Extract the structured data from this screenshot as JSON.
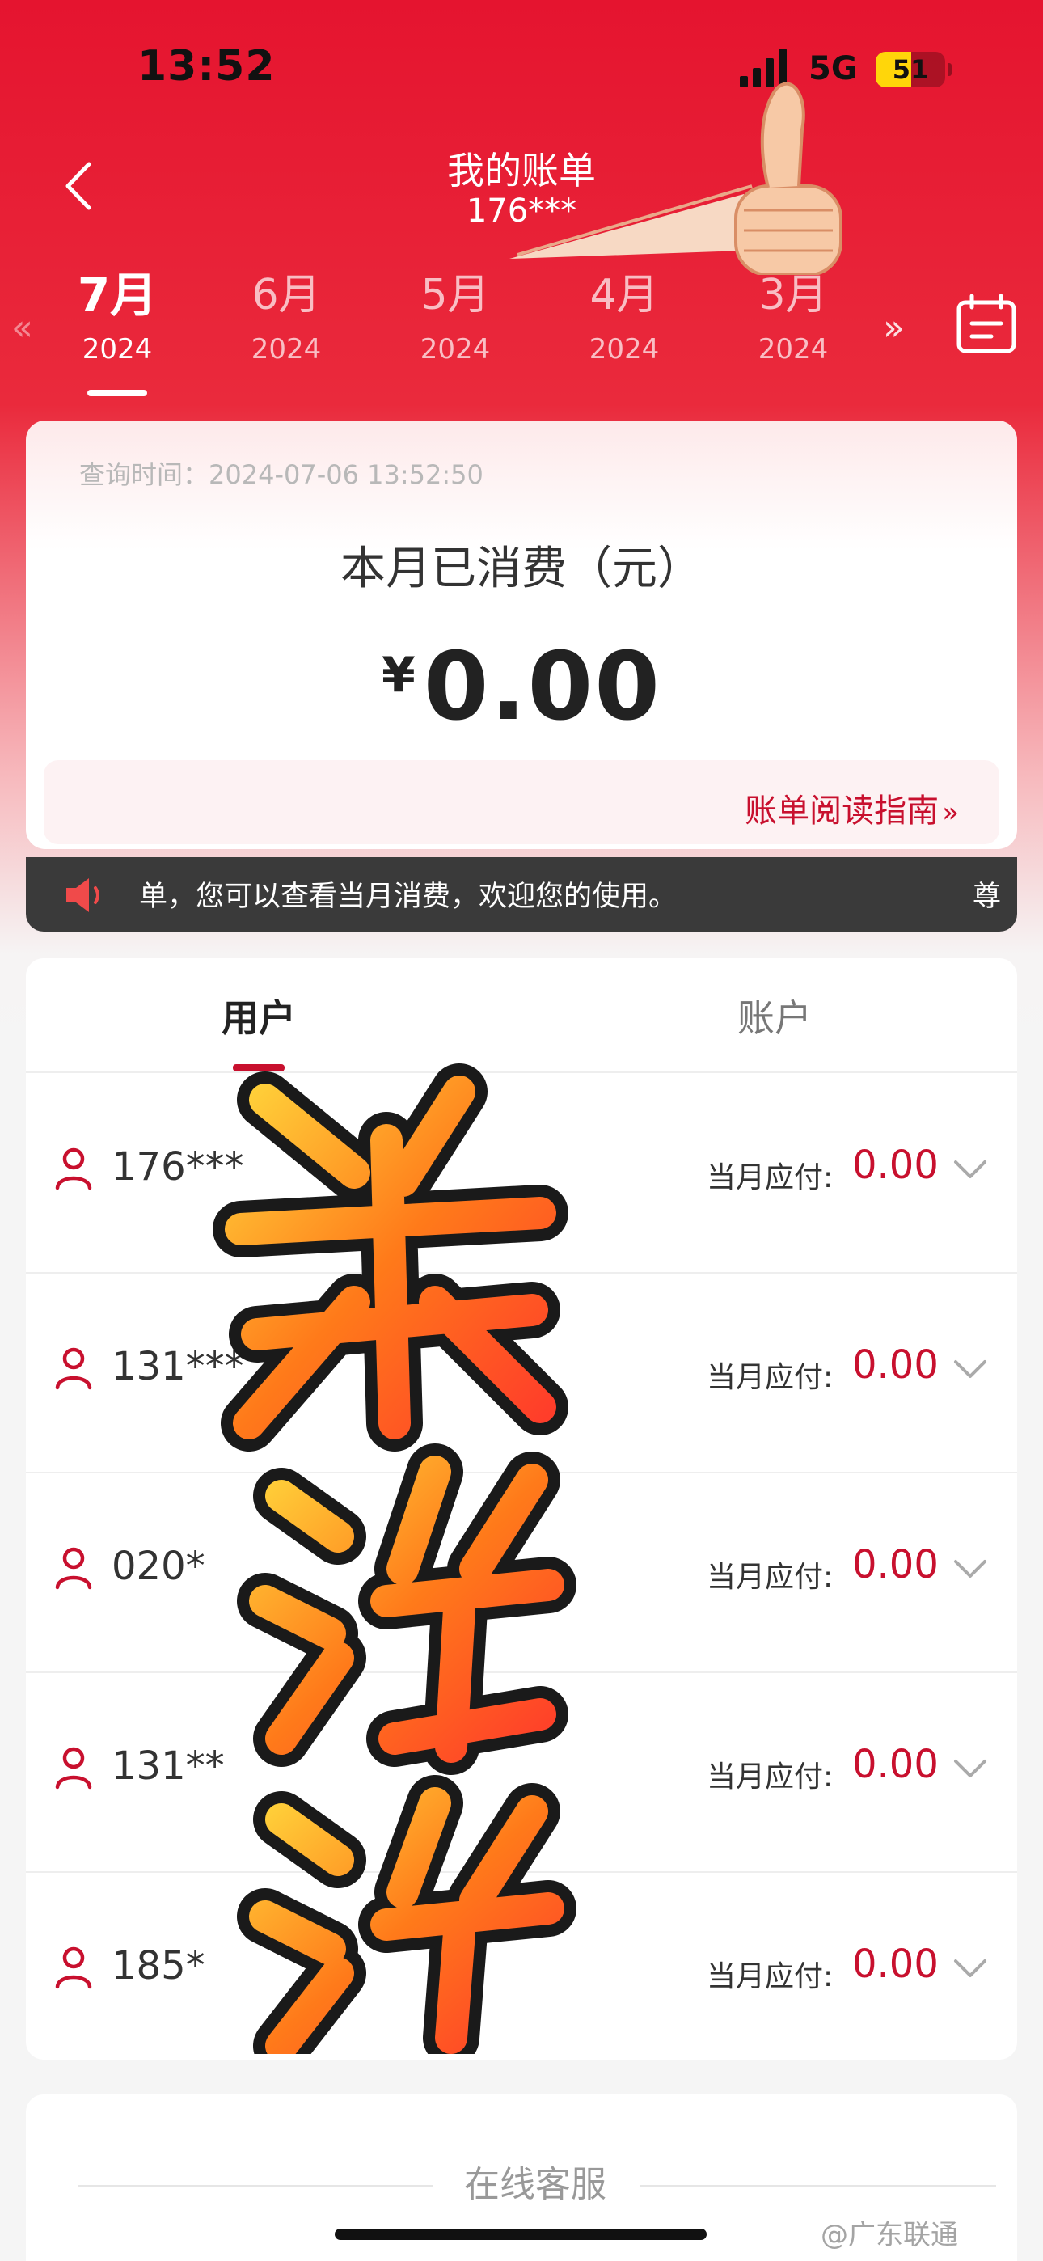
{
  "status_bar": {
    "time": "13:52",
    "network": "5G",
    "battery": "51",
    "battery_level": 0.51
  },
  "header": {
    "title": "我的账单",
    "subtitle": "176***"
  },
  "month_tabs": [
    {
      "month": "7月",
      "year": "2024",
      "active": true
    },
    {
      "month": "6月",
      "year": "2024",
      "active": false
    },
    {
      "month": "5月",
      "year": "2024",
      "active": false
    },
    {
      "month": "4月",
      "year": "2024",
      "active": false
    },
    {
      "month": "3月",
      "year": "2024",
      "active": false
    }
  ],
  "arrows": {
    "prev": "«",
    "next": "»"
  },
  "summary": {
    "query_time": "查询时间：2024-07-06 13:52:50",
    "label": "本月已消费（元）",
    "currency": "¥",
    "amount": "0.00",
    "guide_link": "账单阅读指南",
    "guide_chevron": "»"
  },
  "notice": {
    "text": "单，您可以查看当月消费，欢迎您的使用。",
    "tail": "尊"
  },
  "tabs": [
    {
      "label": "用户",
      "active": true
    },
    {
      "label": "账户",
      "active": false
    }
  ],
  "users": [
    {
      "number": "176***",
      "due_label": "当月应付:",
      "due": "0.00"
    },
    {
      "number": "131***",
      "due_label": "当月应付:",
      "due": "0.00"
    },
    {
      "number": "020*",
      "due_label": "当月应付:",
      "due": "0.00"
    },
    {
      "number": "131**",
      "due_label": "当月应付:",
      "due": "0.00"
    },
    {
      "number": "185*",
      "due_label": "当月应付:",
      "due": "0.00"
    }
  ],
  "bottom": {
    "customer_service": "在线客服"
  },
  "watermark": "@广东联通",
  "colors": {
    "brand_red": "#e5142f",
    "amount_red": "#c8102e",
    "notice_bg": "#3a3a3a"
  }
}
